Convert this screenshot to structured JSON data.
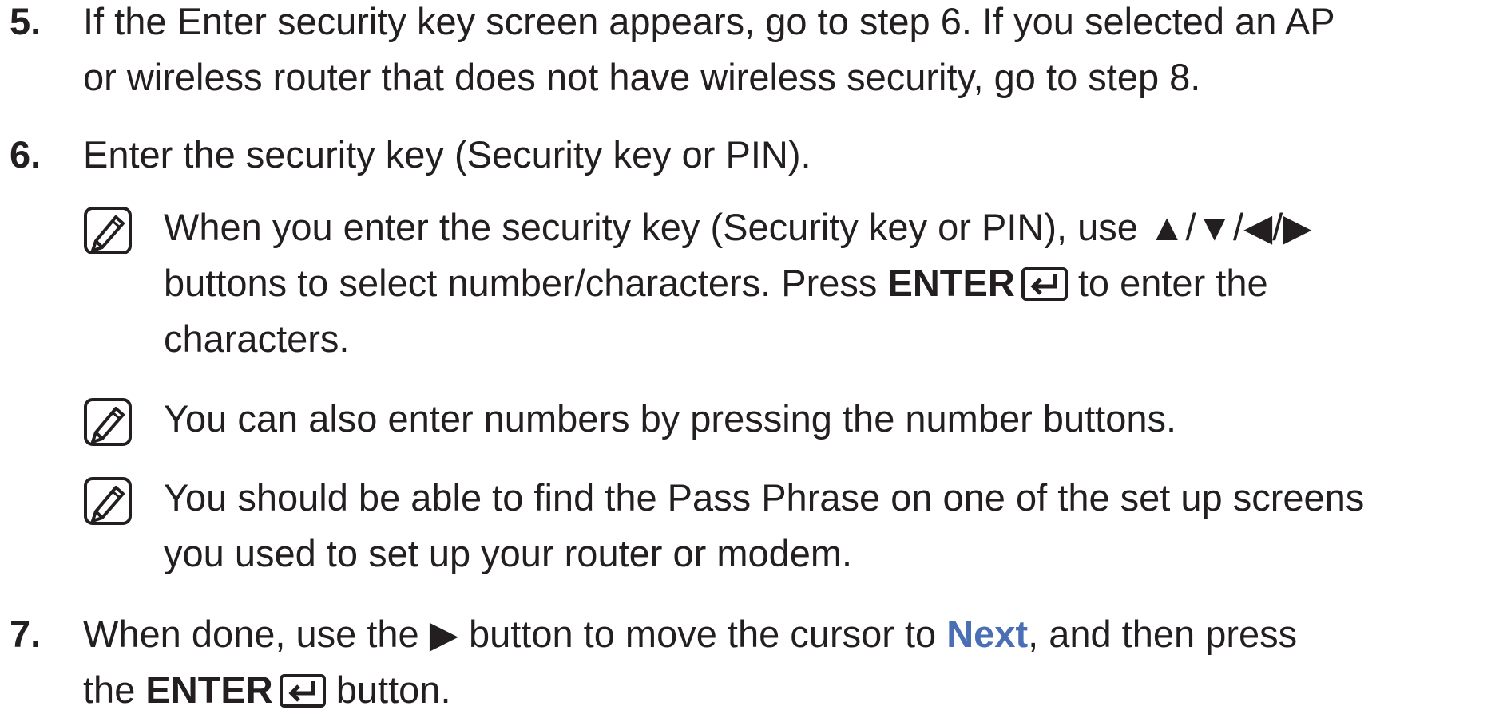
{
  "steps": {
    "s5": {
      "number": "5.",
      "line1": "If the Enter security key screen appears, go to step 6. If you selected an AP",
      "line2": "or wireless router that does not have wireless security, go to step 8."
    },
    "s6": {
      "number": "6.",
      "line1": "Enter the security key (Security key or PIN).",
      "notes": [
        {
          "line1": "When you enter the security key (Security key or PIN), use ▲/▼/◀/▶",
          "line2_a": "buttons to select number/characters. Press",
          "line2_bold": "ENTER",
          "line2_b": "to enter the",
          "line3": "characters."
        },
        {
          "line1": "You can also enter numbers by pressing the number buttons."
        },
        {
          "line1": "You should be able to find the Pass Phrase on one of the set up screens",
          "line2": "you used to set up your router or modem."
        }
      ]
    },
    "s7": {
      "number": "7.",
      "line1_a": "When done, use the ▶ button to move the cursor to",
      "line1_link": "Next",
      "line1_b": ", and then press",
      "line2_a": "the",
      "line2_bold": "ENTER",
      "line2_b": "button."
    }
  },
  "icons": {
    "note": "note-pencil-icon",
    "enter": "enter-key-icon"
  },
  "colors": {
    "text": "#231f20",
    "link": "#4a6fb5"
  }
}
